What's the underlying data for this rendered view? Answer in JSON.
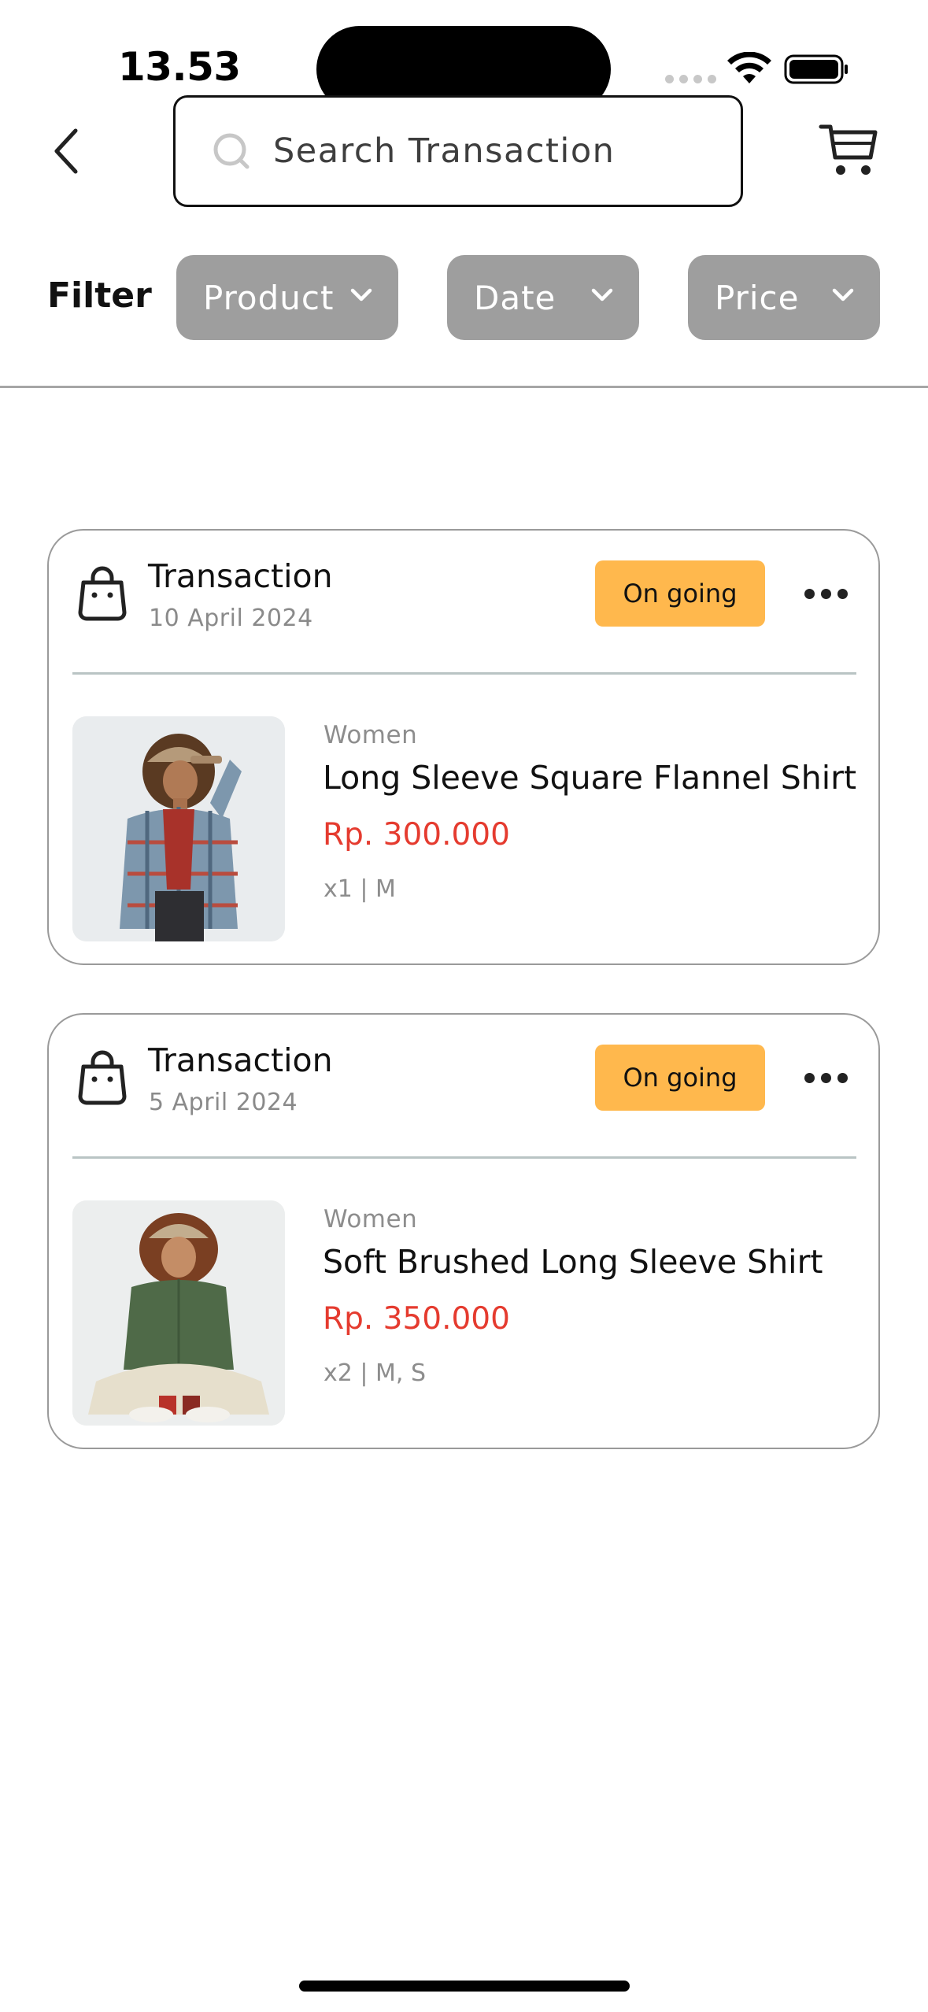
{
  "status_bar": {
    "time": "13.53"
  },
  "header": {
    "search_placeholder": "Search Transaction"
  },
  "filters": {
    "label": "Filter",
    "chips": [
      {
        "label": "Product"
      },
      {
        "label": "Date"
      },
      {
        "label": "Price"
      }
    ]
  },
  "transactions": [
    {
      "title": "Transaction",
      "date": "10 April 2024",
      "status": "On going",
      "item": {
        "category": "Women",
        "name": "Long Sleeve Square Flannel Shirt",
        "price": "Rp. 300.000",
        "variant": "x1 | M"
      }
    },
    {
      "title": "Transaction",
      "date": "5 April 2024",
      "status": "On going",
      "item": {
        "category": "Women",
        "name": "Soft Brushed Long Sleeve Shirt",
        "price": "Rp. 350.000",
        "variant": "x2 | M, S"
      }
    }
  ],
  "colors": {
    "status_badge": "#ffb84d",
    "price": "#e53b2f",
    "chip": "#9e9e9e"
  },
  "icons": [
    "back-icon",
    "search-icon",
    "cart-icon",
    "chevron-down-icon",
    "shopping-bag-icon",
    "more-icon"
  ]
}
